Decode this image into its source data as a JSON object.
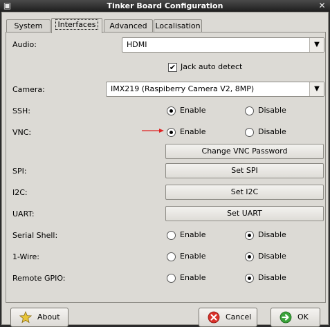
{
  "window": {
    "title": "Tinker Board Configuration"
  },
  "tabs": [
    {
      "label": "System"
    },
    {
      "label": "Interfaces"
    },
    {
      "label": "Advanced"
    },
    {
      "label": "Localisation"
    }
  ],
  "audio": {
    "label": "Audio:",
    "value": "HDMI",
    "jack_label": "Jack auto detect",
    "jack_checked": true
  },
  "camera": {
    "label": "Camera:",
    "value": "IMX219 (Raspiberry Camera V2, 8MP)"
  },
  "options": {
    "enable": "Enable",
    "disable": "Disable"
  },
  "ssh": {
    "label": "SSH:",
    "selected": "Enable"
  },
  "vnc": {
    "label": "VNC:",
    "selected": "Enable",
    "change_button": "Change VNC Password"
  },
  "spi": {
    "label": "SPI:",
    "button": "Set SPI"
  },
  "i2c": {
    "label": "I2C:",
    "button": "Set I2C"
  },
  "uart": {
    "label": "UART:",
    "button": "Set UART"
  },
  "serial_shell": {
    "label": "Serial Shell:",
    "selected": "Disable"
  },
  "one_wire": {
    "label": "1-Wire:",
    "selected": "Disable"
  },
  "remote_gpio": {
    "label": "Remote GPIO:",
    "selected": "Disable"
  },
  "footer": {
    "about": "About",
    "cancel": "Cancel",
    "ok": "OK"
  },
  "colors": {
    "annotation_arrow": "#e02020",
    "cancel_icon": "#d9302a",
    "ok_icon": "#3aa33a",
    "about_icon": "#e8c53a"
  }
}
